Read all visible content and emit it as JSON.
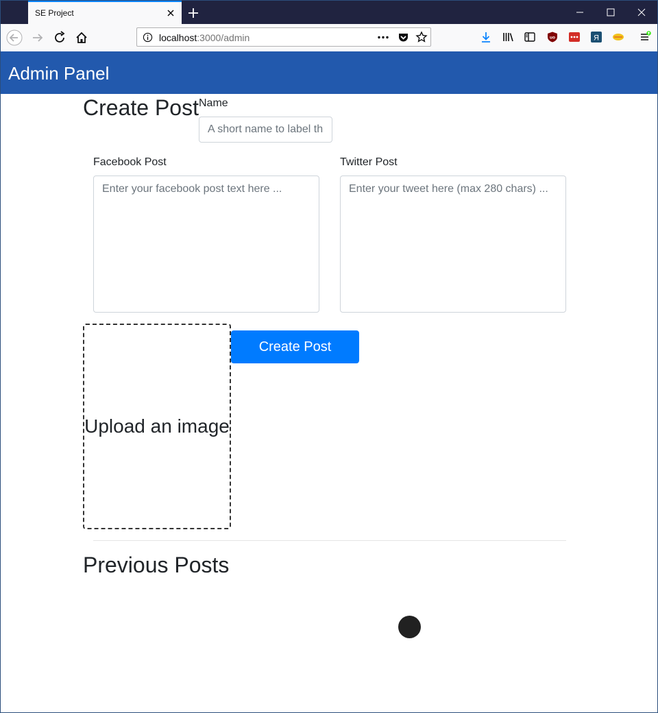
{
  "browser": {
    "tab_title": "SE Project",
    "url_host": "localhost",
    "url_path": ":3000/admin"
  },
  "icons": {
    "back": "arrow-left-icon",
    "forward": "arrow-right-icon",
    "reload": "reload-icon",
    "home": "home-icon",
    "info": "info-icon",
    "more": "ellipsis-icon",
    "pocket": "pocket-icon",
    "bookmark": "star-icon",
    "download": "download-icon",
    "library": "library-icon",
    "sidebar": "sidebar-icon",
    "menu": "hamburger-menu-icon"
  },
  "colors": {
    "appbar": "#2259ad",
    "primary_button": "#007bff",
    "tabbar": "#202340"
  },
  "header": {
    "title": "Admin Panel"
  },
  "create_post": {
    "heading": "Create Post",
    "name_label": "Name",
    "name_placeholder": "A short name to label th",
    "facebook_label": "Facebook Post",
    "facebook_placeholder": "Enter your facebook post text here ...",
    "twitter_label": "Twitter Post",
    "twitter_placeholder": "Enter your tweet here (max 280 chars) ...",
    "upload_text": "Upload an image",
    "submit_label": "Create Post"
  },
  "previous_posts": {
    "heading": "Previous Posts"
  }
}
